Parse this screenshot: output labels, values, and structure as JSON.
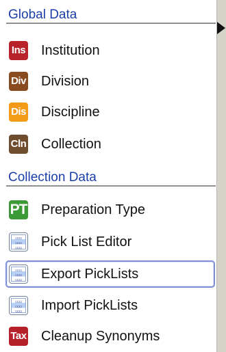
{
  "sections": [
    {
      "title": "Global Data",
      "items": [
        {
          "label": "Institution",
          "icon": "institution-icon",
          "abbr": "Ins",
          "color": "#b8232b"
        },
        {
          "label": "Division",
          "icon": "division-icon",
          "abbr": "Div",
          "color": "#8a4b20"
        },
        {
          "label": "Discipline",
          "icon": "discipline-icon",
          "abbr": "Dis",
          "color": "#f39a17"
        },
        {
          "label": "Collection",
          "icon": "collection-icon",
          "abbr": "Cln",
          "color": "#6f4d2f"
        }
      ]
    },
    {
      "title": "Collection Data",
      "items": [
        {
          "label": "Preparation Type",
          "icon": "preparation-type-icon",
          "abbr": "PT",
          "color": "#3c9a36"
        },
        {
          "label": "Pick List Editor",
          "icon": "pick-list-icon",
          "abbr": "",
          "color": "#3f5fa5"
        },
        {
          "label": "Export PickLists",
          "icon": "export-picklists-icon",
          "abbr": "",
          "color": "#3f5fa5",
          "selected": true
        },
        {
          "label": "Import PickLists",
          "icon": "import-picklists-icon",
          "abbr": "",
          "color": "#3f5fa5"
        },
        {
          "label": "Cleanup Synonyms",
          "icon": "taxon-icon",
          "abbr": "Tax",
          "color": "#b5202b"
        }
      ]
    }
  ]
}
